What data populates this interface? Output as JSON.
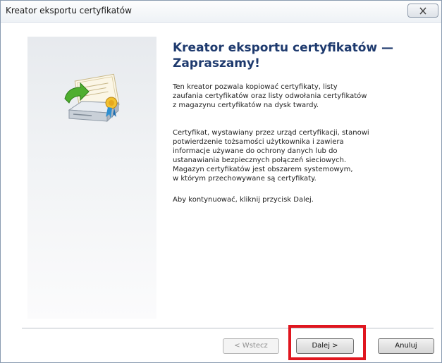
{
  "window": {
    "title": "Kreator eksportu certyfikatów"
  },
  "wizard": {
    "heading": "Kreator eksportu certyfikatów — Zapraszamy!",
    "paragraph1": "Ten kreator pozwala kopiować certyfikaty, listy\nzaufania certyfikatów oraz listy odwołania certyfikatów\nz magazynu certyfikatów na dysk twardy.",
    "paragraph2": "Certyfikat, wystawiany przez urząd certyfikacji, stanowi\npotwierdzenie tożsamości użytkownika i zawiera\ninformacje używane do ochrony danych lub do\nustanawiania bezpiecznych połączeń sieciowych.\nMagazyn certyfikatów jest obszarem systemowym,\nw którym przechowywane są certyfikaty.",
    "paragraph3": "Aby kontynuować, kliknij przycisk Dalej.",
    "icon": "certificate-export-icon"
  },
  "buttons": {
    "back": "< Wstecz",
    "next": "Dalej >",
    "cancel": "Anuluj"
  },
  "colors": {
    "heading": "#1e3a6e",
    "highlight": "#e0161f"
  }
}
